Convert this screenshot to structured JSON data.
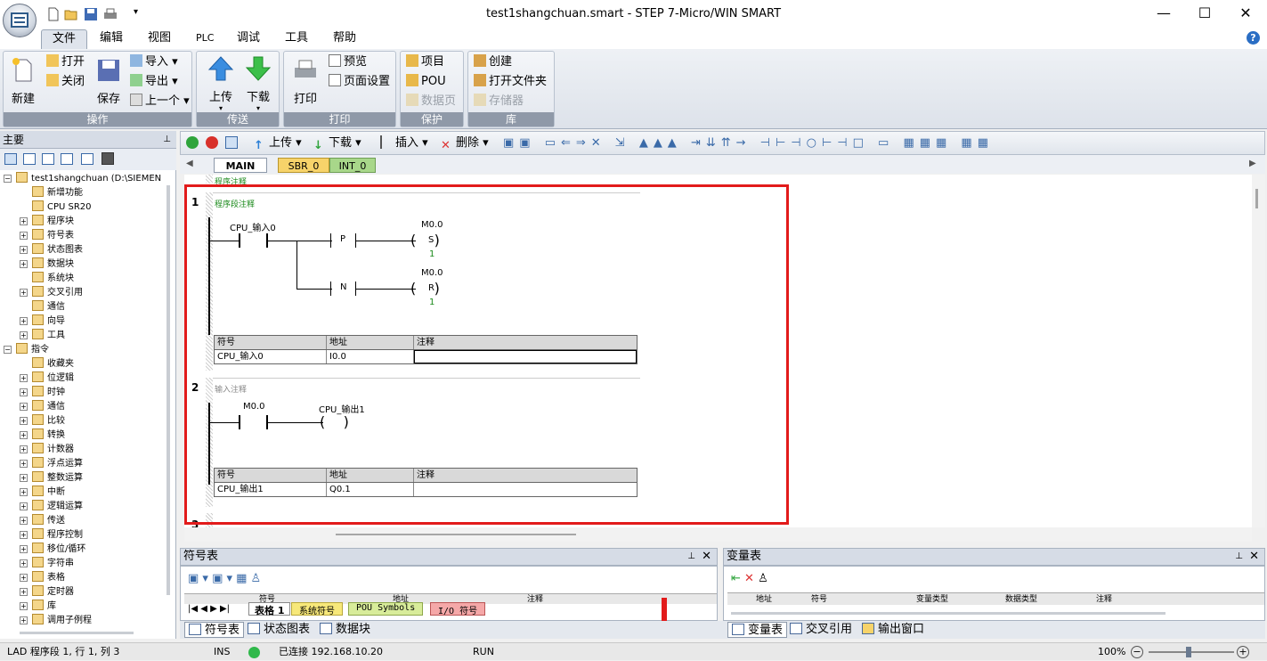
{
  "window": {
    "title": "test1shangchuan.smart - STEP 7-Micro/WIN SMART",
    "controls": {
      "minimize": "—",
      "maximize": "☐",
      "close": "✕"
    }
  },
  "ribbon": {
    "tabs": [
      "文件",
      "编辑",
      "视图",
      "PLC",
      "调试",
      "工具",
      "帮助"
    ],
    "active_tab": "文件",
    "groups": {
      "operation": {
        "label": "操作",
        "new": "新建",
        "open": "打开",
        "close": "关闭",
        "save": "保存",
        "import": "导入",
        "export": "导出",
        "previous": "上一个"
      },
      "transfer": {
        "label": "传送",
        "upload": "上传",
        "download": "下载"
      },
      "print": {
        "label": "打印",
        "print": "打印",
        "preview": "预览",
        "page_setup": "页面设置"
      },
      "protect": {
        "label": "保护",
        "project": "项目",
        "pou": "POU",
        "data_page": "数据页"
      },
      "library": {
        "label": "库",
        "create": "创建",
        "open_folder": "打开文件夹",
        "memory": "存储器"
      }
    }
  },
  "left_panel": {
    "title": "主要",
    "tree": [
      {
        "label": "test1shangchuan (D:\\SIEMEN",
        "indent": 0,
        "expander": "−"
      },
      {
        "label": "新增功能",
        "indent": 1,
        "expander": ""
      },
      {
        "label": "CPU SR20",
        "indent": 1,
        "expander": ""
      },
      {
        "label": "程序块",
        "indent": 1,
        "expander": "+"
      },
      {
        "label": "符号表",
        "indent": 1,
        "expander": "+"
      },
      {
        "label": "状态图表",
        "indent": 1,
        "expander": "+"
      },
      {
        "label": "数据块",
        "indent": 1,
        "expander": "+"
      },
      {
        "label": "系统块",
        "indent": 1,
        "expander": ""
      },
      {
        "label": "交叉引用",
        "indent": 1,
        "expander": "+"
      },
      {
        "label": "通信",
        "indent": 1,
        "expander": ""
      },
      {
        "label": "向导",
        "indent": 1,
        "expander": "+"
      },
      {
        "label": "工具",
        "indent": 1,
        "expander": "+"
      },
      {
        "label": "指令",
        "indent": 0,
        "expander": "−"
      },
      {
        "label": "收藏夹",
        "indent": 1,
        "expander": ""
      },
      {
        "label": "位逻辑",
        "indent": 1,
        "expander": "+"
      },
      {
        "label": "时钟",
        "indent": 1,
        "expander": "+"
      },
      {
        "label": "通信",
        "indent": 1,
        "expander": "+"
      },
      {
        "label": "比较",
        "indent": 1,
        "expander": "+"
      },
      {
        "label": "转换",
        "indent": 1,
        "expander": "+"
      },
      {
        "label": "计数器",
        "indent": 1,
        "expander": "+"
      },
      {
        "label": "浮点运算",
        "indent": 1,
        "expander": "+"
      },
      {
        "label": "整数运算",
        "indent": 1,
        "expander": "+"
      },
      {
        "label": "中断",
        "indent": 1,
        "expander": "+"
      },
      {
        "label": "逻辑运算",
        "indent": 1,
        "expander": "+"
      },
      {
        "label": "传送",
        "indent": 1,
        "expander": "+"
      },
      {
        "label": "程序控制",
        "indent": 1,
        "expander": "+"
      },
      {
        "label": "移位/循环",
        "indent": 1,
        "expander": "+"
      },
      {
        "label": "字符串",
        "indent": 1,
        "expander": "+"
      },
      {
        "label": "表格",
        "indent": 1,
        "expander": "+"
      },
      {
        "label": "定时器",
        "indent": 1,
        "expander": "+"
      },
      {
        "label": "库",
        "indent": 1,
        "expander": "+"
      },
      {
        "label": "调用子例程",
        "indent": 1,
        "expander": "+"
      }
    ]
  },
  "editor": {
    "toolbar": {
      "upload": "上传",
      "download": "下载",
      "insert": "插入",
      "delete": "删除"
    },
    "pou_tabs": [
      {
        "label": "MAIN",
        "active": true,
        "color": "#ffffff"
      },
      {
        "label": "SBR_0",
        "active": false,
        "color": "#f7d36a"
      },
      {
        "label": "INT_0",
        "active": false,
        "color": "#a8d78a"
      }
    ],
    "program_comment": "程序注释",
    "networks": [
      {
        "number": "1",
        "comment": "程序段注释",
        "contact": "CPU_输入0",
        "p_edge": "P",
        "n_edge": "N",
        "coil1_addr": "M0.0",
        "coil1_type": "S",
        "coil1_n": "1",
        "coil2_addr": "M0.0",
        "coil2_type": "R",
        "coil2_n": "1",
        "table_headers": [
          "符号",
          "地址",
          "注释"
        ],
        "symbol": "CPU_输入0",
        "address": "I0.0",
        "note": ""
      },
      {
        "number": "2",
        "comment": "输入注释",
        "contact": "M0.0",
        "coil": "CPU_输出1",
        "table_headers": [
          "符号",
          "地址",
          "注释"
        ],
        "symbol": "CPU_输出1",
        "address": "Q0.1",
        "note": ""
      }
    ],
    "next_network_number": "3"
  },
  "symbol_table_panel": {
    "title": "符号表",
    "columns": [
      "",
      "",
      "符号",
      "地址",
      "注释"
    ],
    "sheet_tabs": [
      "表格 1",
      "系统符号",
      "POU Symbols",
      "I/O 符号"
    ]
  },
  "variable_table_panel": {
    "title": "变量表",
    "columns": [
      "地址",
      "符号",
      "变量类型",
      "数据类型",
      "注释"
    ]
  },
  "bottom_tabs": {
    "left": [
      "符号表",
      "状态图表",
      "数据块"
    ],
    "right": [
      "变量表",
      "交叉引用",
      "输出窗口"
    ]
  },
  "status_bar": {
    "position": "LAD 程序段 1, 行 1, 列 3",
    "mode": "INS",
    "connection": "已连接 192.168.10.20",
    "run_state": "RUN",
    "zoom": "100%"
  },
  "colors": {
    "highlight_box": "#e21b1b",
    "connected": "#2fb84a",
    "ribbon_label": "#8f99a8"
  }
}
